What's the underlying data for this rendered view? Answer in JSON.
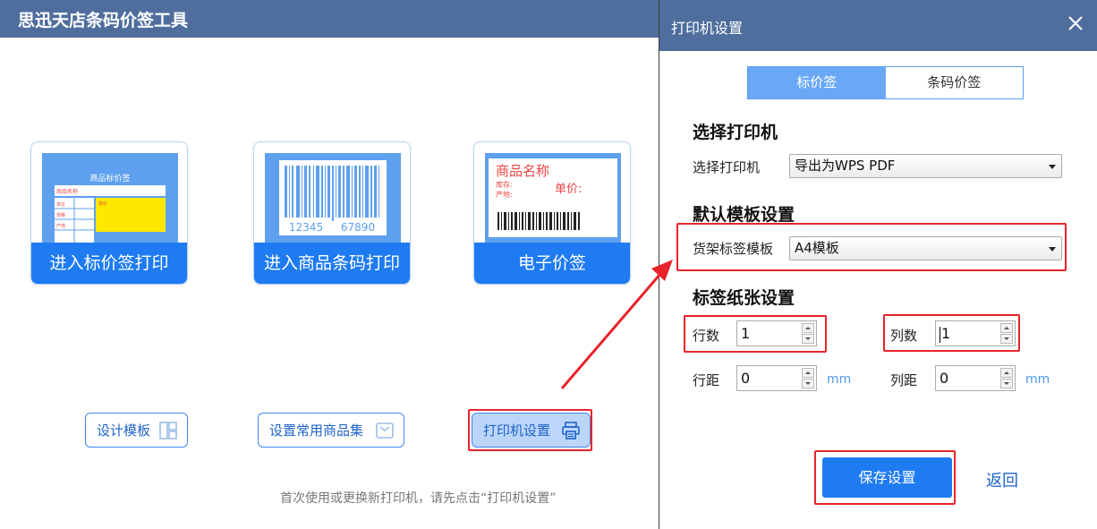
{
  "main": {
    "title": "思迅天店条码价签工具",
    "cards": [
      {
        "label": "进入标价签打印"
      },
      {
        "label": "进入商品条码打印"
      },
      {
        "label": "电子价签"
      }
    ],
    "thumb_price_tag": {
      "header": "商品标价签",
      "rows": [
        "商品名称",
        "单位",
        "规格",
        "产地"
      ],
      "price_label": "单价"
    },
    "thumb_barcode": {
      "digits_left": "12345",
      "digits_right": "67890"
    },
    "thumb_electronic": {
      "name": "商品名称",
      "stock": "库存:",
      "origin": "产地:",
      "unit_price": "单价:"
    },
    "buttons": {
      "design_template": "设计模板",
      "common_products": "设置常用商品集",
      "printer_settings": "打印机设置"
    },
    "hint": "首次使用或更换新打印机，请先点击“打印机设置”"
  },
  "dialog": {
    "title": "打印机设置",
    "tabs": [
      {
        "label": "标价签",
        "active": true
      },
      {
        "label": "条码价签",
        "active": false
      }
    ],
    "printer_section": {
      "heading": "选择打印机",
      "label": "选择打印机",
      "value": "导出为WPS PDF"
    },
    "template_section": {
      "heading": "默认模板设置",
      "label": "货架标签模板",
      "value": "A4模板"
    },
    "paper_section": {
      "heading": "标签纸张设置",
      "rows_label": "行数",
      "rows_value": "1",
      "cols_label": "列数",
      "cols_value": "1",
      "row_gap_label": "行距",
      "row_gap_value": "0",
      "col_gap_label": "列距",
      "col_gap_value": "0",
      "unit": "mm"
    },
    "save_label": "保存设置",
    "back_label": "返回"
  },
  "colors": {
    "titlebar": "#4f6e9e",
    "primary": "#1f7bf2",
    "highlight": "#e8232b",
    "tab_active": "#6aa8f6"
  },
  "icons": [
    "template-layout-icon",
    "product-set-icon",
    "printer-icon",
    "close-icon"
  ]
}
